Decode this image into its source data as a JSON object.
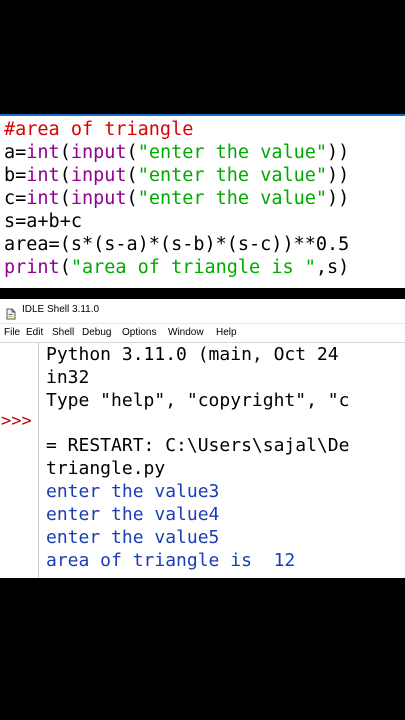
{
  "editor": {
    "lines": [
      {
        "comment": "#area of triangle"
      },
      {
        "pre": "a=",
        "builtin1": "int",
        "mid": "(",
        "builtin2": "input",
        "open": "(",
        "str": "\"enter the value\"",
        "post": "))"
      },
      {
        "pre": "b=",
        "builtin1": "int",
        "mid": "(",
        "builtin2": "input",
        "open": "(",
        "str": "\"enter the value\"",
        "post": "))"
      },
      {
        "pre": "c=",
        "builtin1": "int",
        "mid": "(",
        "builtin2": "input",
        "open": "(",
        "str": "\"enter the value\"",
        "post": "))"
      },
      {
        "text": "s=a+b+c"
      },
      {
        "text": "area=(s*(s-a)*(s-b)*(s-c))**0.5"
      },
      {
        "builtin": "print",
        "open": "(",
        "str": "\"area of triangle is \"",
        "post": ",s)"
      }
    ]
  },
  "shell": {
    "title": "IDLE Shell 3.11.0",
    "menu": [
      "File",
      "Edit",
      "Shell",
      "Debug",
      "Options",
      "Window",
      "Help"
    ],
    "prompt": ">>>",
    "banner": [
      "Python 3.11.0 (main, Oct 24",
      "in32",
      "Type \"help\", \"copyright\", \"c"
    ],
    "restart": [
      "= RESTART: C:\\Users\\sajal\\De",
      "triangle.py"
    ],
    "output": [
      "enter the value3",
      "enter the value4",
      "enter the value5",
      "area of triangle is  12"
    ]
  },
  "colors": {
    "comment": "#dd0000",
    "builtin": "#900090",
    "string": "#00aa00",
    "stdout": "#1b3db3",
    "prompt": "#c00000"
  }
}
